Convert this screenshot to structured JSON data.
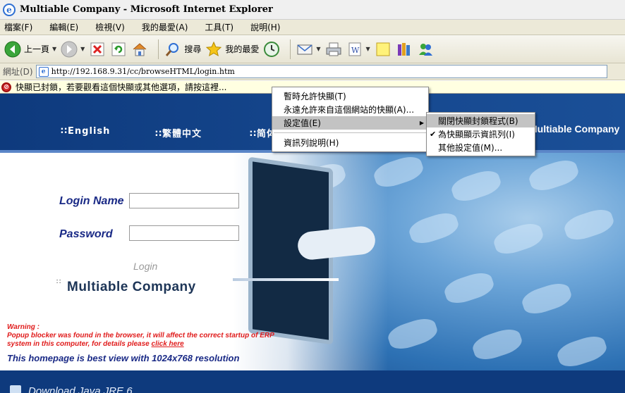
{
  "window": {
    "title": "Multiable Company - Microsoft Internet Explorer"
  },
  "menubar": {
    "items": [
      "檔案(F)",
      "編輯(E)",
      "檢視(V)",
      "我的最愛(A)",
      "工具(T)",
      "說明(H)"
    ]
  },
  "toolbar": {
    "back_label": "上一頁",
    "search_label": "搜尋",
    "favorites_label": "我的最愛"
  },
  "address": {
    "label": "網址(D)",
    "url": "http://192.168.9.31/cc/browseHTML/login.htm"
  },
  "infobar": {
    "text": "快顯已封鎖，若要觀看這個快顯或其他選項，請按這裡..."
  },
  "banner": {
    "lang_en": "English",
    "lang_tc": "繁體中文",
    "lang_sc": "简体",
    "company": "Multiable Company"
  },
  "form": {
    "login_name_label": "Login Name",
    "password_label": "Password",
    "login_button": "Login"
  },
  "brand": {
    "company": "Multiable Company"
  },
  "warning": {
    "title": "Warning :",
    "body": "Popup blocker was found in the browser, it will affect the correct startup of ERP system in this computer, for details please",
    "link": "click here"
  },
  "best_view": "This homepage is best view with 1024x768 resolution",
  "footer": {
    "download": "Download Java JRE 6"
  },
  "context_menu": {
    "items": [
      "暫時允許快顯(T)",
      "永遠允許來自這個網站的快顯(A)...",
      "設定值(E)",
      "資訊列說明(H)"
    ],
    "submenu": [
      "關閉快顯封鎖程式(B)",
      "為快顯顯示資訊列(I)",
      "其他設定值(M)..."
    ]
  }
}
